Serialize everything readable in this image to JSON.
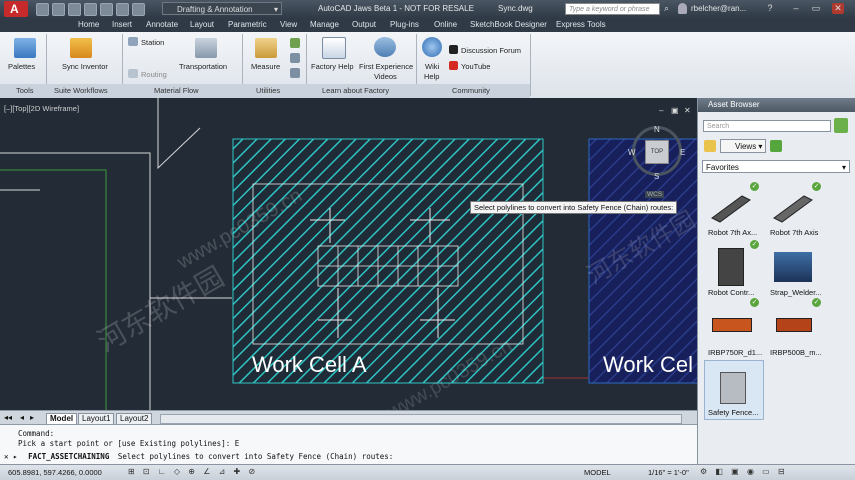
{
  "window": {
    "title": "AutoCAD Jaws Beta 1 - NOT FOR RESALE",
    "file": "Sync.dwg",
    "workspace": "Drafting & Annotation",
    "search_placeholder": "Type a keyword or phrase",
    "user": "rbelcher@ran..."
  },
  "menu_tabs": [
    "Home",
    "Insert",
    "Annotate",
    "Layout",
    "Parametric",
    "View",
    "Manage",
    "Output",
    "Plug-ins",
    "Online",
    "SketchBook Designer",
    "Express Tools"
  ],
  "ribbon": {
    "buttons": {
      "palettes": "Palettes",
      "sync_inventor": "Sync Inventor",
      "station": "Station",
      "routing": "Routing",
      "transportation": "Transportation",
      "measure": "Measure",
      "factory_help": "Factory Help",
      "first_experience": "First Experience",
      "videos": "Videos",
      "wiki": "Wiki",
      "help": "Help",
      "discussion_forum": "Discussion Forum",
      "youtube": "YouTube"
    },
    "panels": [
      "Tools",
      "Suite Workflows",
      "Material Flow",
      "Utilities",
      "Learn about Factory",
      "Community"
    ]
  },
  "viewport": {
    "label": "[–][Top][2D Wireframe]",
    "cell_a": "Work Cell A",
    "cell_b": "Work Cel",
    "tooltip": "Select polylines to convert into Safety Fence (Chain) routes:",
    "viewcube_top": "TOP",
    "compass": {
      "n": "N",
      "s": "S",
      "e": "E",
      "w": "W"
    },
    "wcs": "WCS"
  },
  "watermarks": [
    "河东软件园",
    "www.pc0359.cn"
  ],
  "asset_browser": {
    "title": "Asset Browser",
    "search_placeholder": "Search",
    "views_label": "Views",
    "category": "Favorites",
    "items": [
      {
        "label": "Robot 7th Ax...",
        "icon": "robot-rail-icon"
      },
      {
        "label": "Robot 7th Axis",
        "icon": "robot-rail-icon"
      },
      {
        "label": "Robot Contr...",
        "icon": "robot-controller-icon"
      },
      {
        "label": "Strap_Welder...",
        "icon": "strap-welder-icon"
      },
      {
        "label": "IRBP750R_d1...",
        "icon": "positioner-icon"
      },
      {
        "label": "IRBP500B_m...",
        "icon": "positioner-icon"
      },
      {
        "label": "Safety Fence...",
        "icon": "safety-fence-icon"
      }
    ]
  },
  "layout_tabs": [
    "Model",
    "Layout1",
    "Layout2"
  ],
  "command_line": {
    "history1": "Command:",
    "history2": "Pick a start point or [use Existing polylines]: E",
    "prompt_cmd": "FACT_ASSETCHAINING",
    "prompt_text": "Select polylines to convert into Safety Fence (Chain) routes:"
  },
  "status_bar": {
    "coords": "605.8981, 597.4266, 0.0000",
    "model": "MODEL",
    "scale": "1/16\" = 1'-0\""
  },
  "colors": {
    "hatch": "#2ec4c4",
    "fence": "#3a8a3a",
    "background": "#222b36"
  }
}
